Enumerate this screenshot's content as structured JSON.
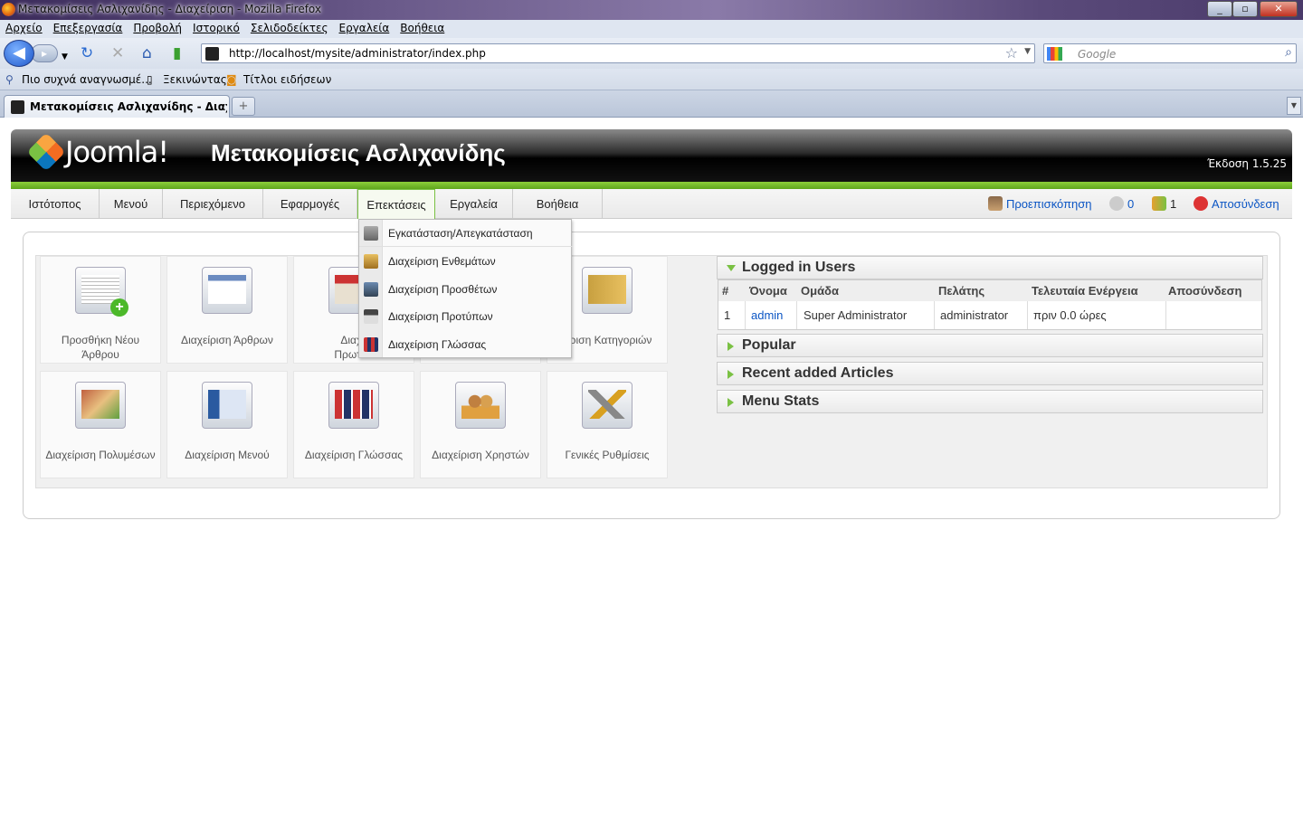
{
  "browser": {
    "window_title": "Μετακομίσεις Ασλιχανίδης - Διαχείριση - Mozilla Firefox",
    "menu": [
      "Αρχείο",
      "Επεξεργασία",
      "Προβολή",
      "Ιστορικό",
      "Σελιδοδείκτες",
      "Εργαλεία",
      "Βοήθεια"
    ],
    "url": "http://localhost/mysite/administrator/index.php",
    "search_placeholder": "Google",
    "bookmarks": [
      "Πιο συχνά αναγνωσμέ...",
      "Ξεκινώντας",
      "Τίτλοι ειδήσεων"
    ],
    "tab_title": "Μετακομίσεις Ασλιχανίδης - Διαχεί...",
    "newtab_label": "+"
  },
  "header": {
    "logo": "Joomla!",
    "site_name": "Μετακομίσεις Ασλιχανίδης",
    "version": "Έκδοση 1.5.25"
  },
  "menu": {
    "items": [
      "Ιστότοπος",
      "Μενού",
      "Περιεχόμενο",
      "Εφαρμογές",
      "Επεκτάσεις",
      "Εργαλεία",
      "Βοήθεια"
    ],
    "active": "Επεκτάσεις",
    "preview": "Προεπισκόπηση",
    "messages": "0",
    "users_online": "1",
    "logout": "Αποσύνδεση"
  },
  "dropdown": [
    "Εγκατάσταση/Απεγκατάσταση",
    "Διαχείριση Ενθεμάτων",
    "Διαχείριση Προσθέτων",
    "Διαχείριση Προτύπων",
    "Διαχείριση Γλώσσας"
  ],
  "icons": [
    {
      "label1": "Προσθήκη Νέου",
      "label2": "Άρθρου",
      "icon": "add-article-icon"
    },
    {
      "label1": "Διαχείριση Άρθρων",
      "label2": "",
      "icon": "articles-icon"
    },
    {
      "label1": "Διαχε",
      "label2": "Πρωτοσ",
      "icon": "frontpage-icon"
    },
    {
      "label1": "",
      "label2": "",
      "icon": "sections-icon"
    },
    {
      "label1": "είριση Κατηγοριών",
      "label2": "",
      "icon": "categories-icon"
    },
    {
      "label1": "Διαχείριση Πολυμέσων",
      "label2": "",
      "icon": "media-icon"
    },
    {
      "label1": "Διαχείριση Μενού",
      "label2": "",
      "icon": "menu-icon"
    },
    {
      "label1": "Διαχείριση Γλώσσας",
      "label2": "",
      "icon": "language-icon"
    },
    {
      "label1": "Διαχείριση Χρηστών",
      "label2": "",
      "icon": "users-icon"
    },
    {
      "label1": "Γενικές Ρυθμίσεις",
      "label2": "",
      "icon": "config-icon"
    }
  ],
  "sections": {
    "logged_in": "Logged in Users",
    "popular": "Popular",
    "recent": "Recent added Articles",
    "menu_stats": "Menu Stats"
  },
  "users_table": {
    "headers": [
      "#",
      "Όνομα",
      "Ομάδα",
      "Πελάτης",
      "Τελευταία Ενέργεια",
      "Αποσύνδεση"
    ],
    "rows": [
      [
        "1",
        "admin",
        "Super Administrator",
        "administrator",
        "πριν 0.0 ώρες",
        ""
      ]
    ]
  }
}
